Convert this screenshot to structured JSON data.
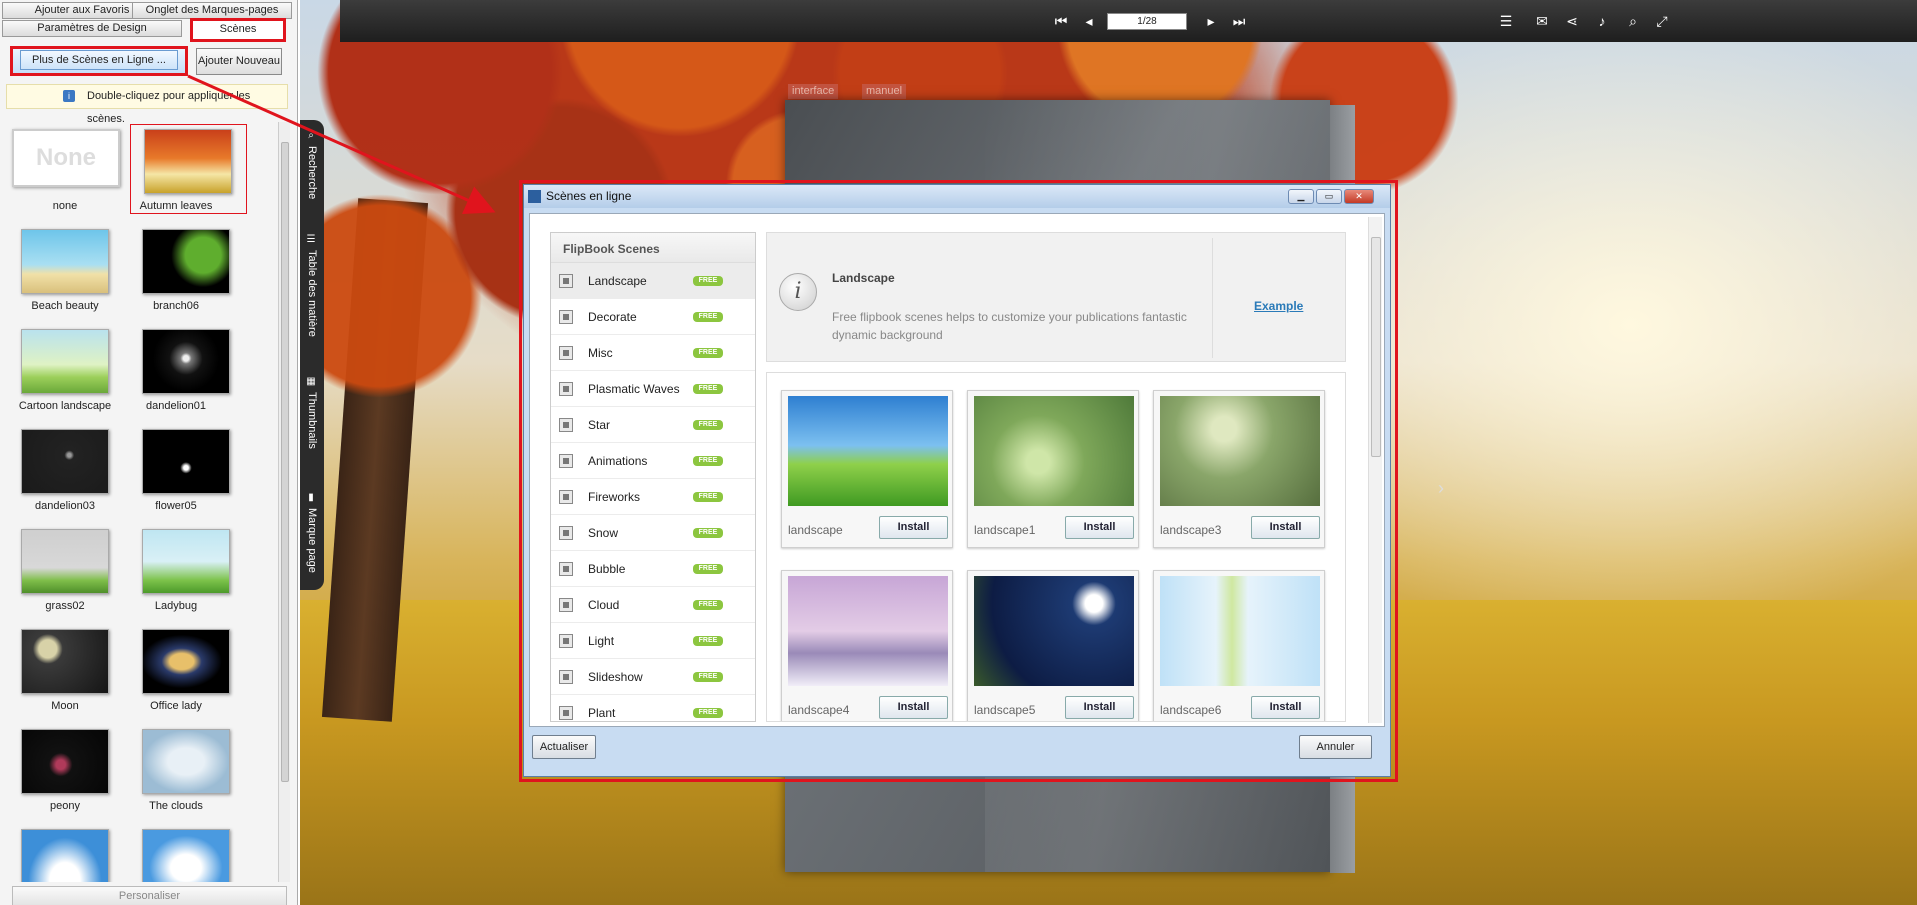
{
  "left_panel": {
    "tabs": {
      "favorites": "Ajouter aux Favoris",
      "bookmarks": "Onglet des Marques-pages",
      "design": "Paramètres de Design",
      "scenes": "Scènes"
    },
    "more_online": "Plus de Scènes en Ligne ...",
    "add_new": "Ajouter Nouveau",
    "hint": "Double-cliquez pour appliquer les scènes.",
    "none_thumb": "None",
    "scenes": [
      {
        "label": "none"
      },
      {
        "label": "Autumn leaves"
      },
      {
        "label": "Beach beauty"
      },
      {
        "label": "branch06"
      },
      {
        "label": "Cartoon landscape"
      },
      {
        "label": "dandelion01"
      },
      {
        "label": "dandelion03"
      },
      {
        "label": "flower05"
      },
      {
        "label": "grass02"
      },
      {
        "label": "Ladybug"
      },
      {
        "label": "Moon"
      },
      {
        "label": "Office lady"
      },
      {
        "label": "peony"
      },
      {
        "label": "The clouds"
      },
      {
        "label": ""
      },
      {
        "label": ""
      }
    ],
    "customize": "Personaliser"
  },
  "preview": {
    "page_indicator": "1/28",
    "book_tabs": [
      "interface",
      "manuel"
    ],
    "side_tabs": {
      "search": "Recherche",
      "toc": "Table des matière",
      "thumbnails": "Thumbnails",
      "bookmark": "Marque page"
    }
  },
  "dialog": {
    "title": "Scènes en ligne",
    "category_header": "FlipBook Scenes",
    "free_badge": "FREE",
    "categories": [
      "Landscape",
      "Decorate",
      "Misc",
      "Plasmatic Waves",
      "Star",
      "Animations",
      "Fireworks",
      "Snow",
      "Bubble",
      "Cloud",
      "Light",
      "Slideshow",
      "Plant"
    ],
    "info": {
      "title": "Landscape",
      "description": "Free flipbook scenes helps to customize your publications fantastic dynamic background",
      "example_link": "Example"
    },
    "install_label": "Install",
    "scenes": [
      {
        "name": "landscape"
      },
      {
        "name": "landscape1"
      },
      {
        "name": "landscape3"
      },
      {
        "name": "landscape4"
      },
      {
        "name": "landscape5"
      },
      {
        "name": "landscape6"
      }
    ],
    "refresh": "Actualiser",
    "cancel": "Annuler"
  },
  "colors": {
    "highlight_red": "#e0141d",
    "free_badge": "#8cc63f",
    "link_blue": "#2a7ab8"
  }
}
